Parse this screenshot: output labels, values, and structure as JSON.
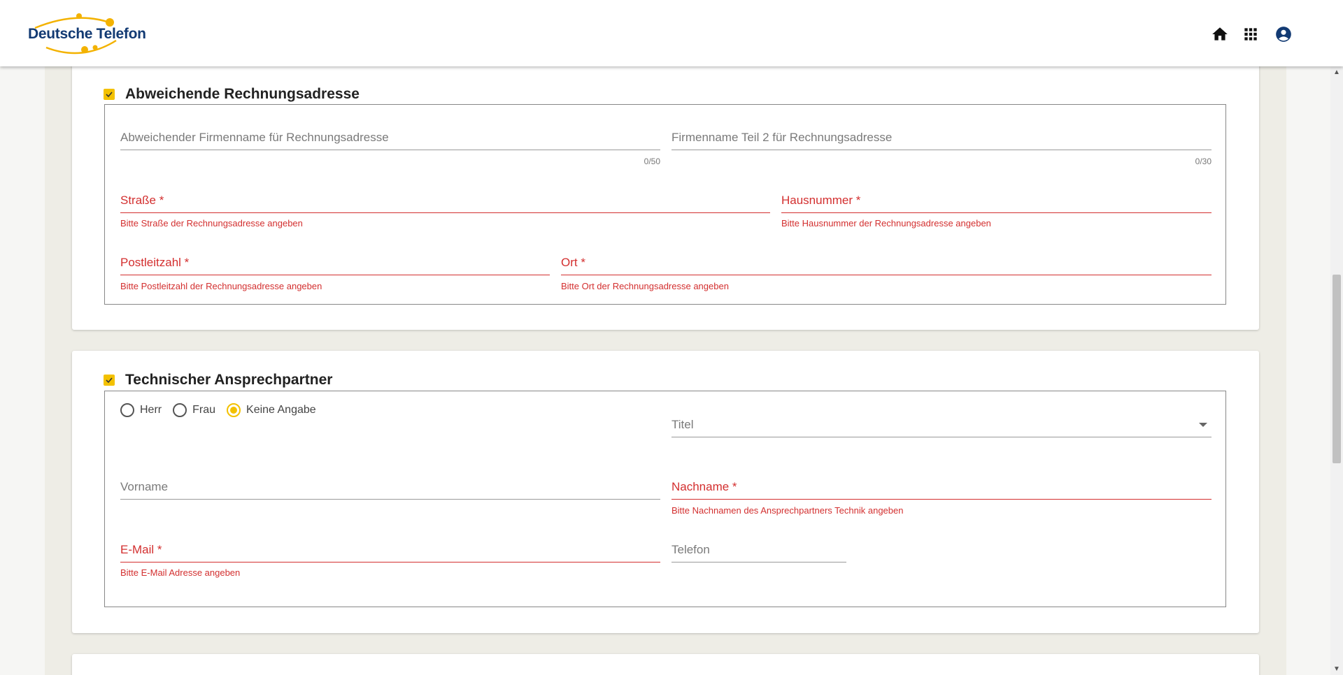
{
  "header": {
    "logo_text": "Deutsche Telefon",
    "icons": [
      "home-icon",
      "apps-grid-icon",
      "account-circle-icon"
    ]
  },
  "billing": {
    "title": "Abweichende Rechnungsadresse",
    "checked": true,
    "company_name_label": "Abweichender Firmenname für Rechnungsadresse",
    "company_name_counter": "0/50",
    "company_name2_label": "Firmenname Teil 2 für Rechnungsadresse",
    "company_name2_counter": "0/30",
    "street_label": "Straße *",
    "street_error": "Bitte Straße der Rechnungsadresse angeben",
    "house_label": "Hausnummer *",
    "house_error": "Bitte Hausnummer der Rechnungsadresse angeben",
    "zip_label": "Postleitzahl *",
    "zip_error": "Bitte Postleitzahl der Rechnungsadresse angeben",
    "city_label": "Ort *",
    "city_error": "Bitte Ort der Rechnungsadresse angeben"
  },
  "technical_contact": {
    "title": "Technischer Ansprechpartner",
    "checked": true,
    "salutations": [
      {
        "label": "Herr",
        "selected": false
      },
      {
        "label": "Frau",
        "selected": false
      },
      {
        "label": "Keine Angabe",
        "selected": true
      }
    ],
    "title_select_label": "Titel",
    "firstname_label": "Vorname",
    "lastname_label": "Nachname *",
    "lastname_error": "Bitte Nachnamen des Ansprechpartners Technik angeben",
    "email_label": "E-Mail *",
    "email_error": "Bitte E-Mail Adresse angeben",
    "phone_label": "Telefon"
  },
  "colors": {
    "accent": "#f3c100",
    "error": "#d32f2f",
    "brand_blue": "#123a73"
  }
}
